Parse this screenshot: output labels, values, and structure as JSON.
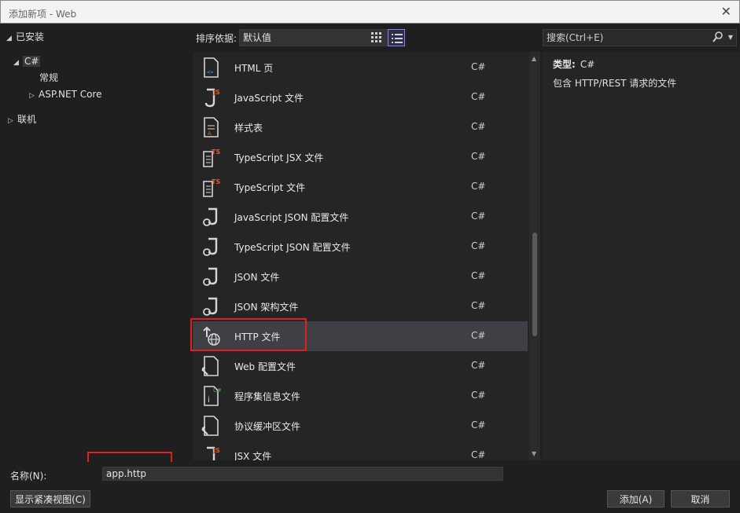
{
  "window": {
    "title": "添加新项 - Web"
  },
  "tree": {
    "installed": "已安装",
    "csharp": "C#",
    "general": "常规",
    "aspnet": "ASP.NET Core",
    "online": "联机"
  },
  "toolbar": {
    "sort_label": "排序依据:",
    "sort_value": "默认值"
  },
  "search": {
    "placeholder": "搜索(Ctrl+E)"
  },
  "templates": [
    {
      "name": "HTML 页",
      "lang": "C#",
      "icon": "html-page-icon"
    },
    {
      "name": "JavaScript 文件",
      "lang": "C#",
      "icon": "javascript-file-icon"
    },
    {
      "name": "样式表",
      "lang": "C#",
      "icon": "stylesheet-icon"
    },
    {
      "name": "TypeScript JSX 文件",
      "lang": "C#",
      "icon": "typescript-jsx-file-icon"
    },
    {
      "name": "TypeScript 文件",
      "lang": "C#",
      "icon": "typescript-file-icon"
    },
    {
      "name": "JavaScript JSON 配置文件",
      "lang": "C#",
      "icon": "json-config-icon"
    },
    {
      "name": "TypeScript JSON 配置文件",
      "lang": "C#",
      "icon": "json-config-icon"
    },
    {
      "name": "JSON 文件",
      "lang": "C#",
      "icon": "json-file-icon"
    },
    {
      "name": "JSON 架构文件",
      "lang": "C#",
      "icon": "json-schema-icon"
    },
    {
      "name": "HTTP 文件",
      "lang": "C#",
      "icon": "http-file-icon"
    },
    {
      "name": "Web 配置文件",
      "lang": "C#",
      "icon": "web-config-icon"
    },
    {
      "name": "程序集信息文件",
      "lang": "C#",
      "icon": "assembly-info-icon"
    },
    {
      "name": "协议缓冲区文件",
      "lang": "C#",
      "icon": "protobuf-file-icon"
    },
    {
      "name": "JSX 文件",
      "lang": "C#",
      "icon": "jsx-file-icon"
    }
  ],
  "selected_index": 9,
  "details": {
    "type_label": "类型:",
    "type_value": "C#",
    "description": "包含 HTTP/REST 请求的文件"
  },
  "bottom": {
    "name_label": "名称(N):",
    "name_value": "app.http",
    "compact_view": "显示紧凑视图(C)",
    "add": "添加(A)",
    "cancel": "取消"
  },
  "colors": {
    "accent": "#8a7cff",
    "highlight": "#e02020",
    "js_badge": "#e05a2b",
    "ts_badge": "#e05a2b",
    "cs_badge": "#4caf50"
  }
}
